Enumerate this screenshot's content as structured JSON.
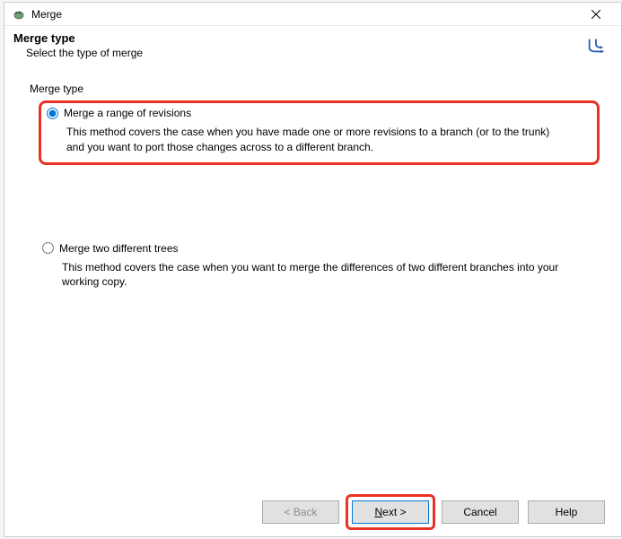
{
  "titlebar": {
    "title": "Merge"
  },
  "header": {
    "title": "Merge type",
    "subtitle": "Select the type of merge"
  },
  "content": {
    "group_label": "Merge type",
    "option1": {
      "label": "Merge a range of revisions",
      "description": "This method covers the case when you have made one or more revisions to a branch (or to the trunk) and you want to port those changes across to a different branch.",
      "checked": true
    },
    "option2": {
      "label": "Merge two different trees",
      "description": "This method covers the case when you want to merge the differences of two different branches into your working copy.",
      "checked": false
    }
  },
  "buttons": {
    "back": "< Back",
    "next": "Next >",
    "cancel": "Cancel",
    "help": "Help"
  }
}
